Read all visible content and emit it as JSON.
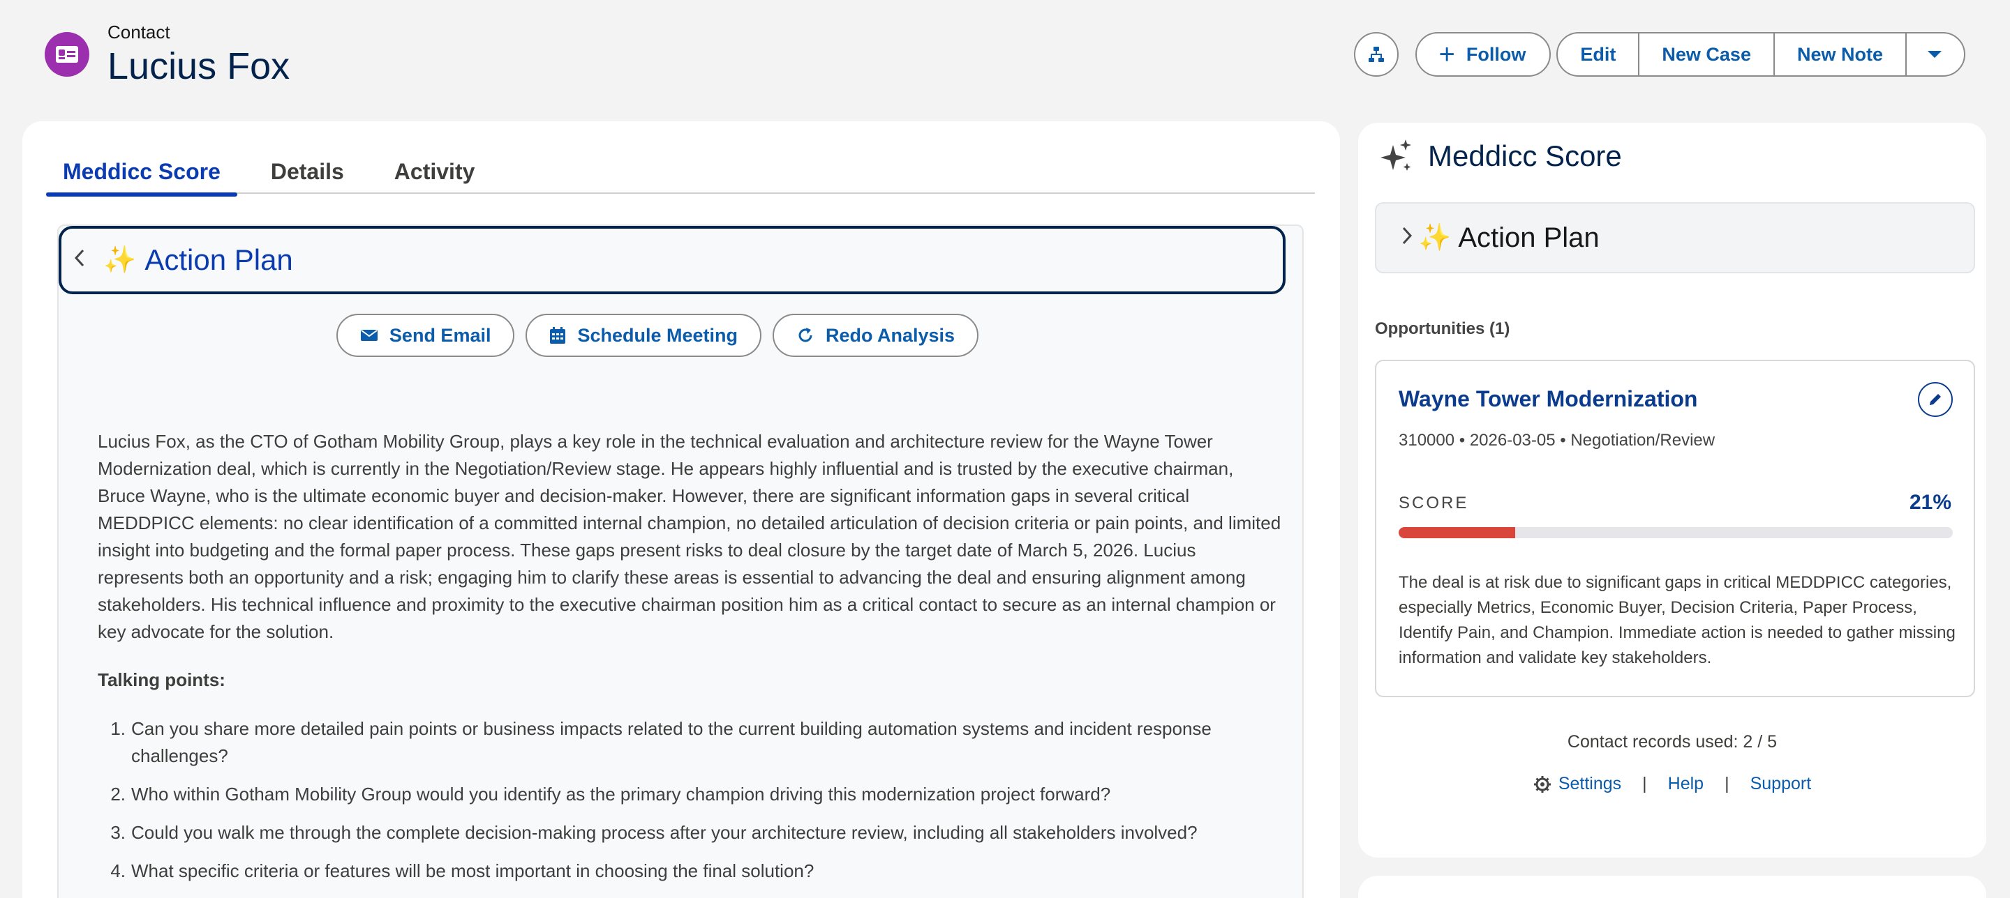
{
  "header": {
    "object_label": "Contact",
    "record_name": "Lucius Fox",
    "icon": "contact-card-icon"
  },
  "actions": {
    "hierarchy_icon": "hierarchy-icon",
    "follow_label": "Follow",
    "edit_label": "Edit",
    "new_case_label": "New Case",
    "new_note_label": "New Note",
    "more_icon": "caret-down-icon"
  },
  "tabs": [
    {
      "label": "Meddicc Score",
      "active": true
    },
    {
      "label": "Details",
      "active": false
    },
    {
      "label": "Activity",
      "active": false
    }
  ],
  "action_plan": {
    "title": "Action Plan",
    "sparkle": "✨",
    "buttons": {
      "send_email": "Send Email",
      "schedule_meeting": "Schedule Meeting",
      "redo_analysis": "Redo Analysis"
    },
    "summary": "Lucius Fox, as the CTO of Gotham Mobility Group, plays a key role in the technical evaluation and architecture review for the Wayne Tower Modernization deal, which is currently in the Negotiation/Review stage. He appears highly influential and is trusted by the executive chairman, Bruce Wayne, who is the ultimate economic buyer and decision-maker. However, there are significant information gaps in several critical MEDDPICC elements: no clear identification of a committed internal champion, no detailed articulation of decision criteria or pain points, and limited insight into budgeting and the formal paper process. These gaps present risks to deal closure by the target date of March 5, 2026. Lucius represents both an opportunity and a risk; engaging him to clarify these areas is essential to advancing the deal and ensuring alignment among stakeholders. His technical influence and proximity to the executive chairman position him as a critical contact to secure as an internal champion or key advocate for the solution.",
    "talking_points_label": "Talking points:",
    "talking_points": [
      {
        "num": "1.",
        "text": "Can you share more detailed pain points or business impacts related to the current building automation systems and incident response challenges?"
      },
      {
        "num": "2.",
        "text": "Who within Gotham Mobility Group would you identify as the primary champion driving this modernization project forward?"
      },
      {
        "num": "3.",
        "text": "Could you walk me through the complete decision-making process after your architecture review, including all stakeholders involved?"
      },
      {
        "num": "4.",
        "text": "What specific criteria or features will be most important in choosing the final solution?"
      }
    ]
  },
  "sidebar": {
    "title": "Meddicc Score",
    "action_plan_label": "Action Plan",
    "opportunities_heading": "Opportunities (1)",
    "opportunity": {
      "name": "Wayne Tower Modernization",
      "meta": "310000 • 2026-03-05 • Negotiation/Review",
      "score_label": "SCORE",
      "score_text": "21%",
      "score_value": 21,
      "description": "The deal is at risk due to significant gaps in critical MEDDPICC categories, especially Metrics, Economic Buyer, Decision Criteria, Paper Process, Identify Pain, and Champion. Immediate action is needed to gather missing information and validate key stakeholders."
    },
    "usage": "Contact records used: 2 / 5",
    "links": {
      "settings": "Settings",
      "help": "Help",
      "support": "Support",
      "separator": "|"
    }
  },
  "colors": {
    "brand_blue": "#0b5cab",
    "score_bar": "#d9453b",
    "contact_icon": "#9b2fae"
  }
}
